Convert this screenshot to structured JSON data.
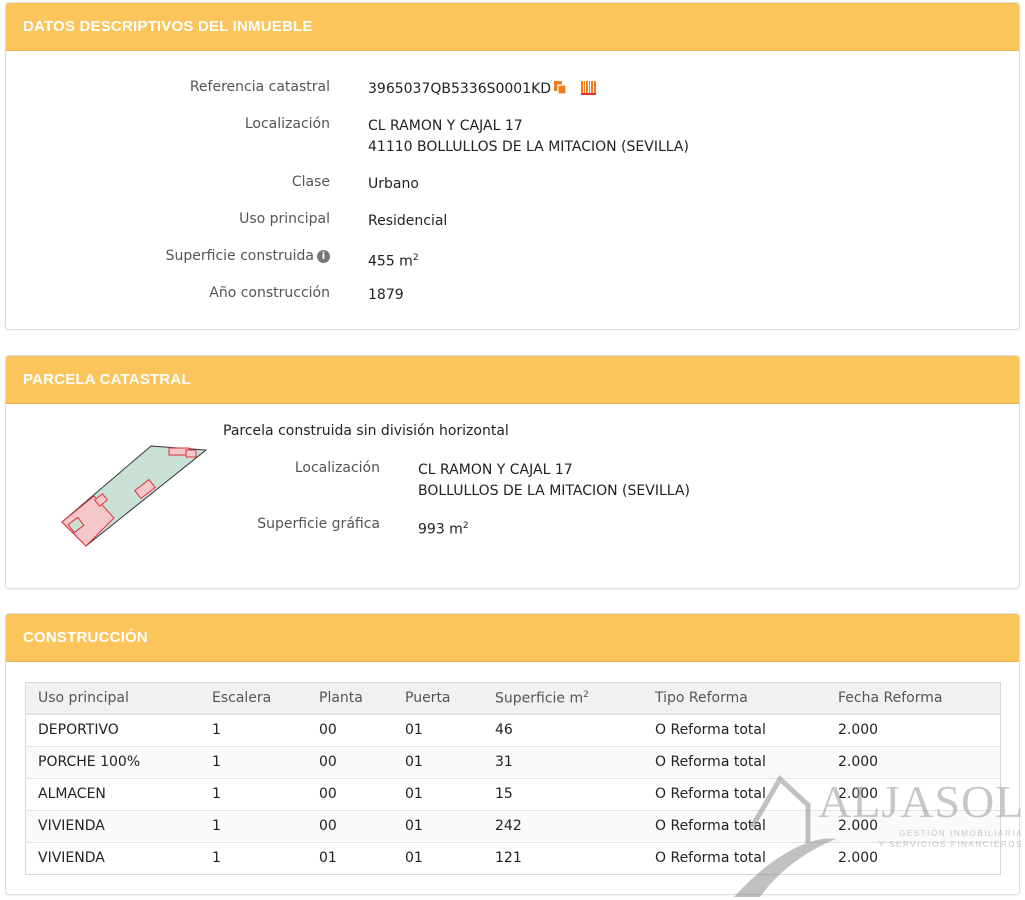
{
  "inmueble": {
    "header": "DATOS DESCRIPTIVOS DEL INMUEBLE",
    "ref_label": "Referencia catastral",
    "ref_value": "3965037QB5336S0001KD",
    "loc_label": "Localización",
    "loc_line1": "CL RAMON Y CAJAL 17",
    "loc_line2": "41110 BOLLULLOS DE LA MITACION (SEVILLA)",
    "clase_label": "Clase",
    "clase_value": "Urbano",
    "uso_label": "Uso principal",
    "uso_value": "Residencial",
    "sup_label": "Superficie construida",
    "sup_value": "455 m",
    "sup_unit_sup": "2",
    "anio_label": "Año construcción",
    "anio_value": "1879"
  },
  "parcela": {
    "header": "PARCELA CATASTRAL",
    "desc": "Parcela construida sin división horizontal",
    "loc_label": "Localización",
    "loc_line1": "CL RAMON Y CAJAL 17",
    "loc_line2": "BOLLULLOS DE LA MITACION (SEVILLA)",
    "sup_label": "Superficie gráfica",
    "sup_value": "993 m",
    "sup_unit_sup": "2"
  },
  "construccion": {
    "header": "CONSTRUCCIÓN",
    "columns": [
      "Uso principal",
      "Escalera",
      "Planta",
      "Puerta",
      "Superficie m",
      "Tipo Reforma",
      "Fecha Reforma"
    ],
    "superficie_sup": "2",
    "rows": [
      [
        "DEPORTIVO",
        "1",
        "00",
        "01",
        "46",
        "O Reforma total",
        "2.000"
      ],
      [
        "PORCHE 100%",
        "1",
        "00",
        "01",
        "31",
        "O Reforma total",
        "2.000"
      ],
      [
        "ALMACEN",
        "1",
        "00",
        "01",
        "15",
        "O Reforma total",
        "2.000"
      ],
      [
        "VIVIENDA",
        "1",
        "00",
        "01",
        "242",
        "O Reforma total",
        "2.000"
      ],
      [
        "VIVIENDA",
        "1",
        "01",
        "01",
        "121",
        "O Reforma total",
        "2.000"
      ]
    ]
  },
  "watermark": {
    "brand": "ALJASOL",
    "tagline1": "GESTIÓN INMOBILIARIA",
    "tagline2": "Y SERVICIOS FINANCIEROS"
  },
  "icons": {
    "copy": "copy-icon",
    "barcode": "barcode-icon",
    "info": "info-icon"
  },
  "colors": {
    "header_bg": "#fcc55b",
    "icon_accent": "#f07e1b",
    "parcel_fill": "#c9e0d5",
    "building_fill": "#f4c7cb",
    "building_stroke": "#e0303a"
  }
}
